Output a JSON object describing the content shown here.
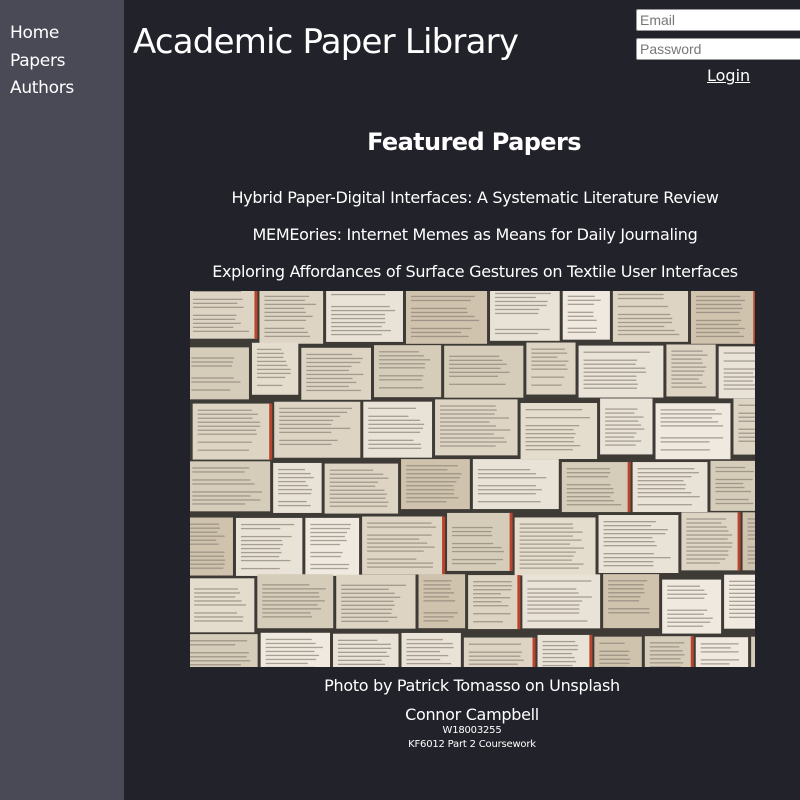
{
  "nav": {
    "items": [
      {
        "label": "Home"
      },
      {
        "label": "Papers"
      },
      {
        "label": "Authors"
      }
    ]
  },
  "header": {
    "title": "Academic Paper Library"
  },
  "login": {
    "email_placeholder": "Email",
    "password_placeholder": "Password",
    "login_label": "Login"
  },
  "featured": {
    "heading": "Featured Papers",
    "papers": [
      {
        "title": "Hybrid Paper-Digital Interfaces: A Systematic Literature Review"
      },
      {
        "title": "MEMEories: Internet Memes as Means for Daily Journaling"
      },
      {
        "title": "Exploring Affordances of Surface Gestures on Textile User Interfaces"
      }
    ]
  },
  "photo": {
    "credit": "Photo by Patrick Tomasso on Unsplash"
  },
  "footer": {
    "name": "Connor Campbell",
    "student_id": "W18003255",
    "course": "KF6012 Part 2 Coursework"
  }
}
